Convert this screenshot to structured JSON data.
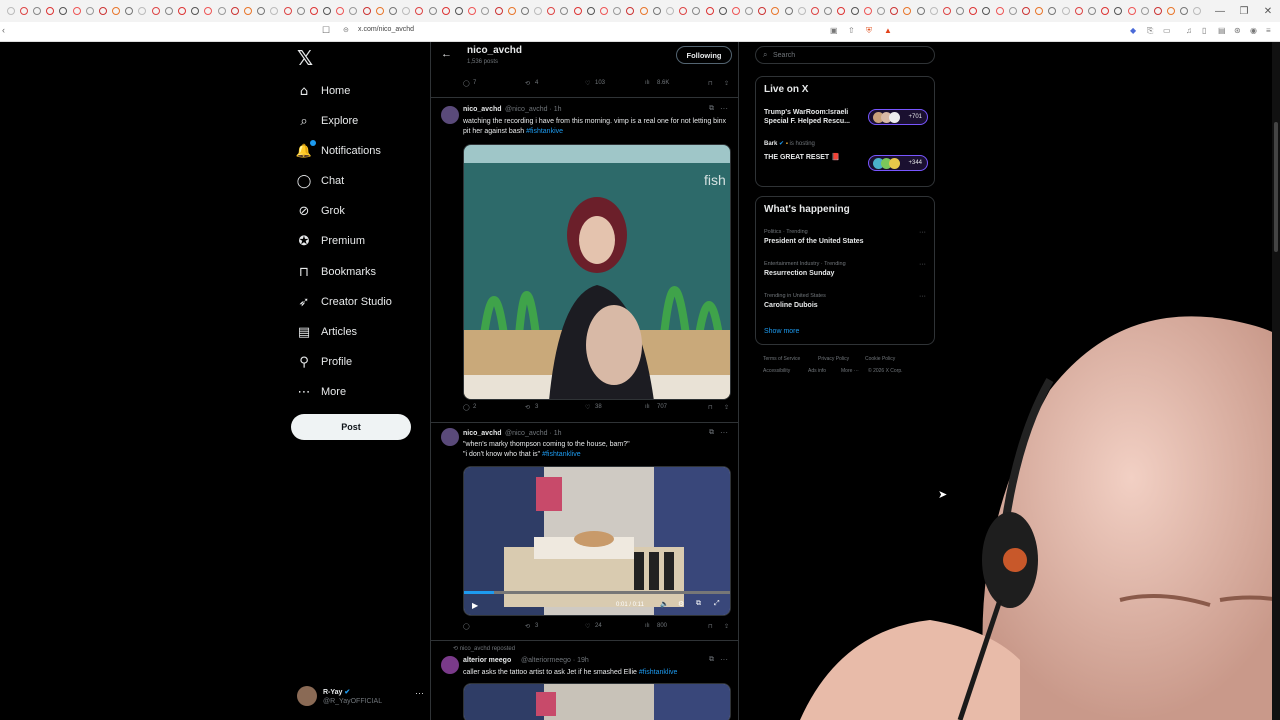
{
  "browser": {
    "url": "x.com/nico_avchd",
    "window_controls": [
      "—",
      "❐",
      "✕"
    ]
  },
  "nav": {
    "items": [
      {
        "label": "Home",
        "icon": "home-icon"
      },
      {
        "label": "Explore",
        "icon": "search-icon"
      },
      {
        "label": "Notifications",
        "icon": "bell-icon"
      },
      {
        "label": "Chat",
        "icon": "chat-icon"
      },
      {
        "label": "Grok",
        "icon": "grok-icon"
      },
      {
        "label": "Premium",
        "icon": "premium-icon"
      },
      {
        "label": "Bookmarks",
        "icon": "bookmark-icon"
      },
      {
        "label": "Creator Studio",
        "icon": "rocket-icon"
      },
      {
        "label": "Articles",
        "icon": "article-icon"
      },
      {
        "label": "Profile",
        "icon": "person-icon"
      },
      {
        "label": "More",
        "icon": "more-circle-icon"
      }
    ],
    "post_label": "Post",
    "account": {
      "name": "R-Yay",
      "handle": "@R_YayOFFICIAL"
    }
  },
  "profile_header": {
    "name": "nico_avchd",
    "post_count": "1,536 posts",
    "follow_label": "Following"
  },
  "top_actions": {
    "replies": "7",
    "reposts": "4",
    "likes": "103",
    "views": "8.6K"
  },
  "tweets": [
    {
      "name": "nico_avchd",
      "meta": "@nico_avchd · 1h",
      "text": "watching the recording i have from this morning. vimp is a real one for not letting binx pit her against bash",
      "hashtag": "#fishtankive",
      "actions": {
        "replies": "2",
        "reposts": "3",
        "likes": "38",
        "views": "707"
      }
    },
    {
      "name": "nico_avchd",
      "meta": "@nico_avchd · 1h",
      "text_line1": "\"when's marky thompson coming to the house, bam?\"",
      "text_line2": "\"i don't know who that is\"",
      "hashtag": "#fishtanklive",
      "video_time": "0:01 / 0:11",
      "actions": {
        "replies": "",
        "reposts": "3",
        "likes": "24",
        "views": "800"
      }
    },
    {
      "repost_note": "nico_avchd reposted",
      "name": "alterior meego",
      "meta": "@alteriormeego · 19h",
      "text": "caller asks the tattoo artist to ask Jet if he smashed Ellie",
      "hashtag": "#fishtanklive"
    }
  ],
  "search": {
    "placeholder": "Search"
  },
  "live": {
    "title": "Live on X",
    "items": [
      {
        "title_line1": "Trump's WarRoom:Israeli",
        "title_line2": "Special F. Helped Rescu...",
        "count": "+701"
      },
      {
        "host": "Bark",
        "hosting": "is hosting",
        "title": "THE GREAT RESET 📕",
        "count": "+344"
      }
    ]
  },
  "happening": {
    "title": "What's happening",
    "items": [
      {
        "meta": "Politics · Trending",
        "name": "President of the United States"
      },
      {
        "meta": "Entertainment Industry · Trending",
        "name": "Resurrection Sunday"
      },
      {
        "meta": "Trending in United States",
        "name": "Caroline Dubois"
      }
    ],
    "show_more": "Show more"
  },
  "footer": {
    "links": [
      "Terms of Service",
      "Privacy Policy",
      "Cookie Policy",
      "Accessibility",
      "Ads info",
      "More ···",
      "© 2026 X Corp."
    ]
  },
  "colors": {
    "accent": "#1d9bf0",
    "background": "#000000",
    "border": "#2f3336",
    "muted": "#71767b",
    "live": "#7856ff"
  }
}
